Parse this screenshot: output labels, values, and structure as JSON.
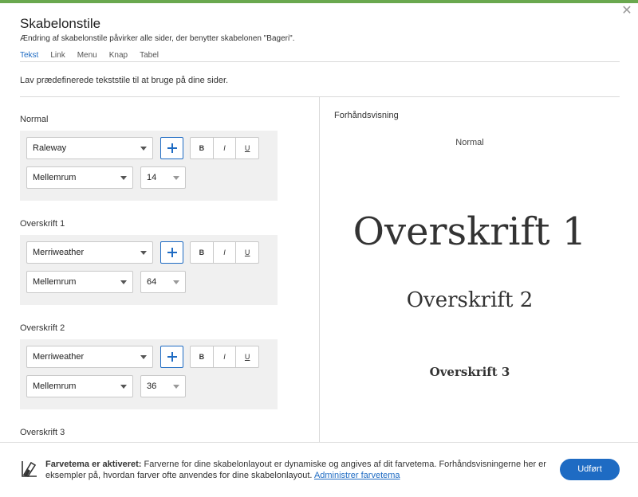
{
  "dialog": {
    "title": "Skabelonstile",
    "subtitle": "Ændring af skabelonstile påvirker alle sider, der benytter skabelonen \"Bageri\".",
    "close_icon": "close-icon"
  },
  "tabs": [
    {
      "label": "Tekst",
      "active": true
    },
    {
      "label": "Link",
      "active": false
    },
    {
      "label": "Menu",
      "active": false
    },
    {
      "label": "Knap",
      "active": false
    },
    {
      "label": "Tabel",
      "active": false
    }
  ],
  "intro": "Lav prædefinerede tekststile til at bruge på dine sider.",
  "format_buttons": {
    "bold": "B",
    "italic": "I",
    "underline": "U"
  },
  "styles": [
    {
      "label": "Normal",
      "font": "Raleway",
      "spacing": "Mellemrum",
      "size": "14"
    },
    {
      "label": "Overskrift 1",
      "font": "Merriweather",
      "spacing": "Mellemrum",
      "size": "64"
    },
    {
      "label": "Overskrift 2",
      "font": "Merriweather",
      "spacing": "Mellemrum",
      "size": "36"
    },
    {
      "label": "Overskrift 3"
    }
  ],
  "preview": {
    "label": "Forhåndsvisning",
    "normal": "Normal",
    "h1": "Overskrift 1",
    "h2": "Overskrift 2",
    "h3": "Overskrift 3"
  },
  "footer": {
    "strong": "Farvetema er aktiveret:",
    "text": " Farverne for dine skabelonlayout er dynamiske og angives af dit farvetema. Forhåndsvisningerne her er eksempler på, hvordan farver ofte anvendes for dine skabelonlayout. ",
    "link": "Administrer farvetema",
    "done_button": "Udført"
  },
  "colors": {
    "accent": "#1e6bc3",
    "top_bar": "#6aa84f",
    "panel_bg": "#f0f0f0"
  }
}
